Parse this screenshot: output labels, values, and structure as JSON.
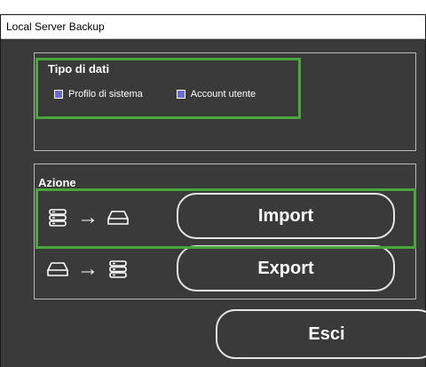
{
  "window": {
    "title": "Local Server Backup"
  },
  "tipo_dati": {
    "title": "Tipo di dati",
    "options": [
      {
        "label": "Profilo di sistema"
      },
      {
        "label": "Account utente"
      }
    ]
  },
  "azione": {
    "title": "Azione",
    "import_label": "Import",
    "export_label": "Export"
  },
  "footer": {
    "exit_label": "Esci"
  },
  "colors": {
    "background": "#3a3a3a",
    "checkbox_fill": "#6b6cc9",
    "highlight": "#4aa63c",
    "text": "#ffffff"
  },
  "icons": [
    "server-stack-icon",
    "arrow-right-icon",
    "drive-icon"
  ]
}
